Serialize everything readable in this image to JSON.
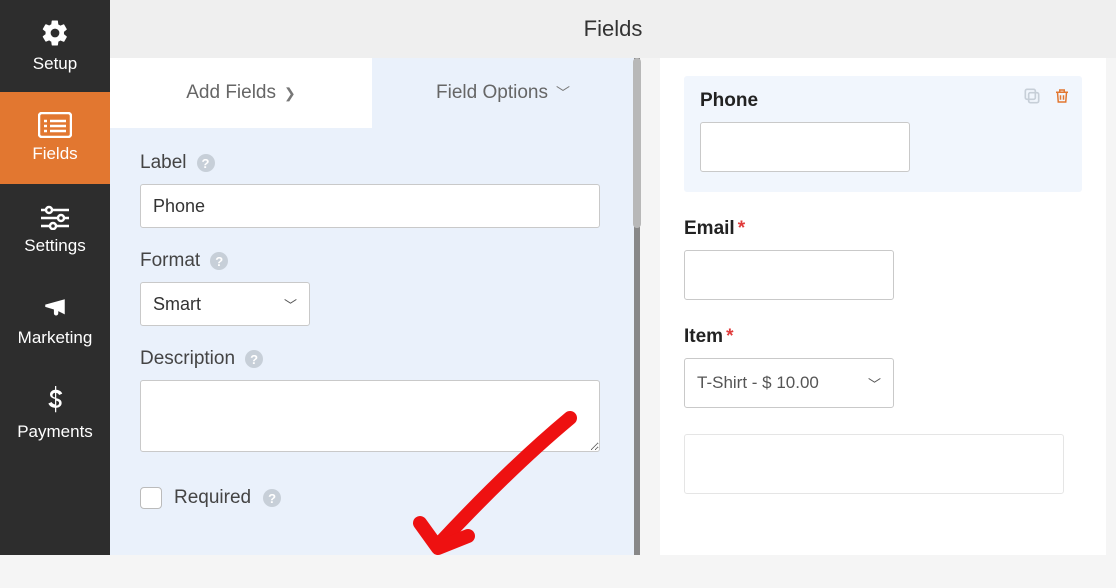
{
  "header": {
    "title": "Fields"
  },
  "sidebar": {
    "items": [
      {
        "label": "Setup"
      },
      {
        "label": "Fields"
      },
      {
        "label": "Settings"
      },
      {
        "label": "Marketing"
      },
      {
        "label": "Payments"
      }
    ]
  },
  "tabs": {
    "add_fields": "Add Fields",
    "field_options": "Field Options"
  },
  "options": {
    "label_caption": "Label",
    "label_value": "Phone",
    "format_caption": "Format",
    "format_value": "Smart",
    "description_caption": "Description",
    "description_value": "",
    "required_caption": "Required"
  },
  "preview": {
    "phone": {
      "label": "Phone"
    },
    "email": {
      "label": "Email"
    },
    "item": {
      "label": "Item",
      "selected": "T-Shirt - $ 10.00"
    }
  }
}
